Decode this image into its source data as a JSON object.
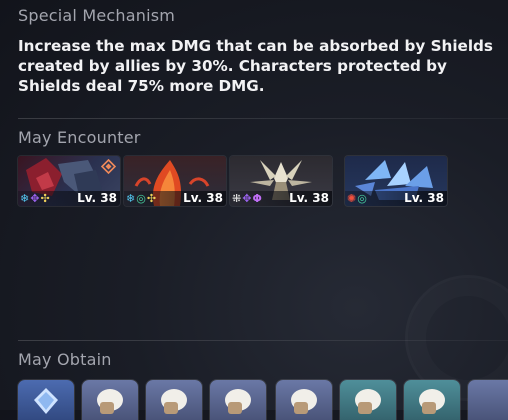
{
  "mechanism": {
    "title": "Special Mechanism",
    "description": "Increase the max DMG that can be absorbed by Shields created by allies by 30%. Characters protected by Shields deal 75% more DMG."
  },
  "encounter": {
    "title": "May Encounter",
    "enemies": [
      {
        "level_text": "Lv. 38",
        "weaknesses": [
          "ice-weakness-icon",
          "quantum-weakness-icon",
          "imaginary-weakness-icon"
        ],
        "boss_icon": "boss-marker-icon"
      },
      {
        "level_text": "Lv. 38",
        "weaknesses": [
          "ice-weakness-icon",
          "wind-weakness-icon",
          "imaginary-weakness-icon"
        ]
      },
      {
        "level_text": "Lv. 38",
        "weaknesses": [
          "physical-weakness-icon",
          "quantum-weakness-icon",
          "lightning-weakness-icon"
        ]
      },
      {
        "level_text": "Lv. 38",
        "weaknesses": [
          "fire-weakness-icon",
          "wind-weakness-icon"
        ]
      }
    ]
  },
  "obtain": {
    "title": "May Obtain",
    "items": [
      "stellar-jade-reward",
      "relic-reward",
      "relic-reward",
      "relic-reward",
      "relic-reward",
      "relic-reward",
      "relic-reward"
    ]
  },
  "colors": {
    "ice": "#53c7f0",
    "quantum": "#9c63f0",
    "imaginary": "#f0d15a",
    "wind": "#49d6a4",
    "fire": "#f2513e",
    "lightning": "#c06ef5",
    "physical": "#d9d9d9"
  }
}
